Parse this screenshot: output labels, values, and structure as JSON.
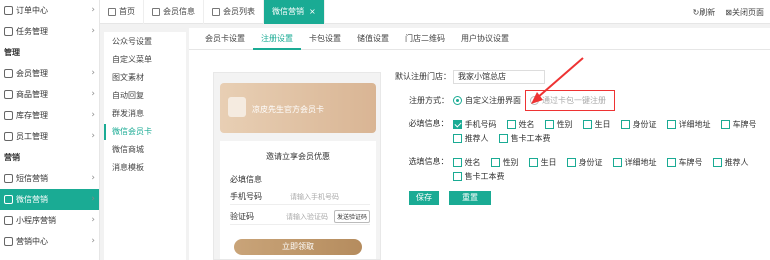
{
  "sidebar": {
    "items": [
      {
        "label": "订单中心",
        "type": "item",
        "icon": "list-icon"
      },
      {
        "label": "任务管理",
        "type": "item",
        "icon": "task-icon"
      },
      {
        "label": "管理",
        "type": "section"
      },
      {
        "label": "会员管理",
        "type": "item",
        "icon": "crown-icon"
      },
      {
        "label": "商品管理",
        "type": "item",
        "icon": "box-icon"
      },
      {
        "label": "库存管理",
        "type": "item",
        "icon": "warehouse-icon"
      },
      {
        "label": "员工管理",
        "type": "item",
        "icon": "user-icon"
      },
      {
        "label": "营销",
        "type": "section"
      },
      {
        "label": "短信营销",
        "type": "item",
        "icon": "sms-icon"
      },
      {
        "label": "微信营销",
        "type": "item",
        "icon": "wechat-icon",
        "active": true
      },
      {
        "label": "小程序营销",
        "type": "item",
        "icon": "miniapp-icon"
      },
      {
        "label": "营销中心",
        "type": "item",
        "icon": "target-icon"
      }
    ]
  },
  "topbar": {
    "tabs": [
      {
        "label": "首页"
      },
      {
        "label": "会员信息"
      },
      {
        "label": "会员列表"
      },
      {
        "label": "微信营销",
        "active": true
      }
    ],
    "refresh": "刷新",
    "close_page": "关闭页面"
  },
  "submenu": [
    "公众号设置",
    "自定义菜单",
    "图文素材",
    "自动回复",
    "群发消息",
    "微信会员卡",
    "微信商城",
    "消息模板"
  ],
  "submenu_active": 5,
  "content_tabs": [
    "会员卡设置",
    "注册设置",
    "卡包设置",
    "储值设置",
    "门店二维码",
    "用户协议设置"
  ],
  "content_tab_active": 1,
  "preview": {
    "card_title": "凉皮先生官方会员卡",
    "box_title": "邀请立享会员优惠",
    "required": "必填信息",
    "phone_label": "手机号码",
    "phone_placeholder": "请输入手机号码",
    "code_label": "验证码",
    "code_placeholder": "请输入验证码",
    "code_button": "发送验证码",
    "submit": "立即领取"
  },
  "form": {
    "store_label": "默认注册门店：",
    "store_value": "我家小馆总店",
    "method_label": "注册方式：",
    "method_custom": "自定义注册界面",
    "method_onekey": "通过卡包一键注册",
    "required_label": "必填信息：",
    "required_fields": [
      {
        "label": "手机号码",
        "checked": true
      },
      {
        "label": "姓名",
        "checked": false
      },
      {
        "label": "性别",
        "checked": false
      },
      {
        "label": "生日",
        "checked": false
      },
      {
        "label": "身份证",
        "checked": false
      },
      {
        "label": "详细地址",
        "checked": false
      },
      {
        "label": "车牌号",
        "checked": false
      },
      {
        "label": "推荐人",
        "checked": false
      },
      {
        "label": "售卡工本费",
        "checked": false
      }
    ],
    "optional_label": "选填信息：",
    "optional_fields": [
      {
        "label": "姓名",
        "checked": false
      },
      {
        "label": "性别",
        "checked": false
      },
      {
        "label": "生日",
        "checked": false
      },
      {
        "label": "身份证",
        "checked": false
      },
      {
        "label": "详细地址",
        "checked": false
      },
      {
        "label": "车牌号",
        "checked": false
      },
      {
        "label": "推荐人",
        "checked": false
      },
      {
        "label": "售卡工本费",
        "checked": false
      }
    ],
    "save": "保存",
    "reset": "重置"
  },
  "colors": {
    "accent": "#1aab94",
    "highlight": "#e33333",
    "card": "#d9b594"
  }
}
